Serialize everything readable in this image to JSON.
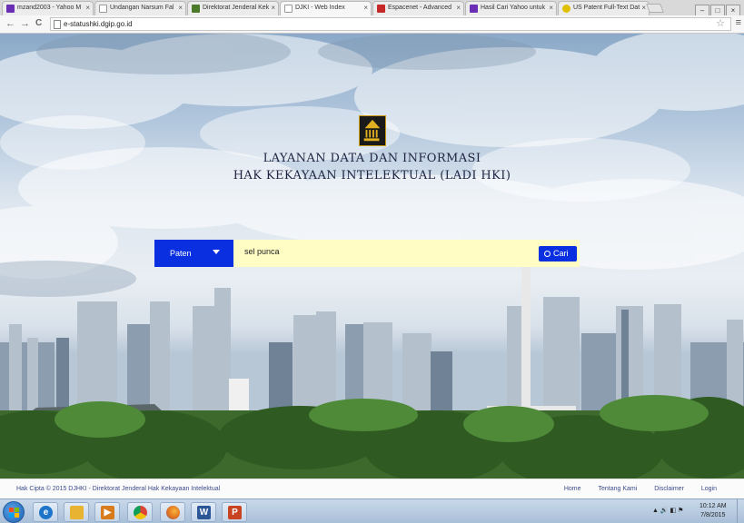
{
  "browser": {
    "tabs": [
      {
        "label": "mzand2003 - Yahoo M",
        "fav": "#6b2fb5"
      },
      {
        "label": "Undangan Narsum Fal",
        "fav": "#ffffff"
      },
      {
        "label": "Direktorat Jenderal Kek",
        "fav": "#4a7a2a"
      },
      {
        "label": "DJKI - Web Index",
        "fav": "#ffffff"
      },
      {
        "label": "Espacenet - Advanced",
        "fav": "#c62828"
      },
      {
        "label": "Hasil Cari Yahoo untuk",
        "fav": "#6b2fb5"
      },
      {
        "label": "US Patent Full-Text Dat",
        "fav": "#e0c000"
      }
    ],
    "tab_close_glyph": "×",
    "url": "e-statushki.dgip.go.id",
    "back_glyph": "←",
    "forward_glyph": "→",
    "reload_glyph": "C",
    "star_glyph": "☆",
    "menu_glyph": "≡",
    "window_buttons": {
      "minimize": "–",
      "maximize": "□",
      "close": "×"
    }
  },
  "page": {
    "title_line1": "LAYANAN DATA DAN INFORMASI",
    "title_line2": "HAK KEKAYAAN INTELEKTUAL (LADI HKI)",
    "search": {
      "category": "Paten",
      "query": "sel punca",
      "button_label": "Cari"
    }
  },
  "footer": {
    "copyright": "Hak Cipta © 2015 DJHKI - Direktorat Jenderal Hak Kekayaan Intelektual",
    "links": [
      "Home",
      "Tentang Kami",
      "Disclaimer",
      "Login"
    ]
  },
  "taskbar": {
    "apps": [
      {
        "icon": "internet-explorer-icon",
        "glyph": "e",
        "color": "#1e74c9"
      },
      {
        "icon": "file-explorer-icon",
        "glyph": "",
        "color": "#e8b330"
      },
      {
        "icon": "media-player-icon",
        "glyph": "▶",
        "color": "#d77b1c"
      },
      {
        "icon": "chrome-icon",
        "glyph": "",
        "color": "#2e9e43"
      },
      {
        "icon": "firefox-icon",
        "glyph": "",
        "color": "#e06d1f"
      },
      {
        "icon": "word-icon",
        "glyph": "W",
        "color": "#2b5797"
      },
      {
        "icon": "powerpoint-icon",
        "glyph": "P",
        "color": "#c8431f"
      }
    ],
    "tray": "▲  🔊  ◧  ⚑",
    "time": "10:12 AM",
    "date": "7/8/2015"
  },
  "colors": {
    "accent": "#0a2fe0",
    "search_bg": "#fffcc4",
    "title": "#1e2340"
  }
}
